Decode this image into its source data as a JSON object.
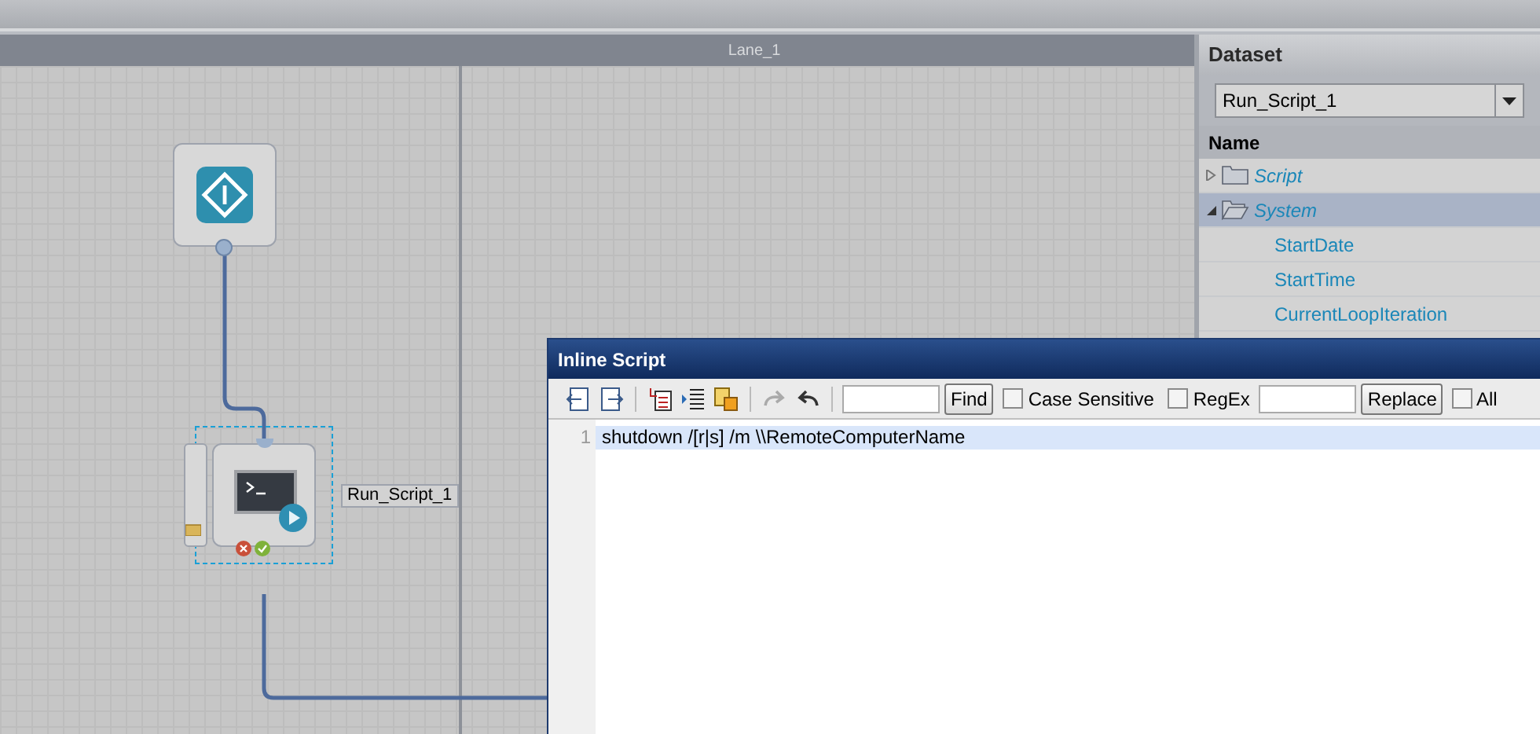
{
  "lane": {
    "title": "Lane_1"
  },
  "canvas": {
    "nodes": [
      {
        "kind": "start"
      },
      {
        "kind": "script",
        "label": "Run_Script_1",
        "selected": true
      }
    ]
  },
  "dataset": {
    "title": "Dataset",
    "dropdown": {
      "value": "Run_Script_1"
    },
    "column": "Name",
    "items": [
      {
        "name": "Script",
        "expanded": false,
        "selected": false
      },
      {
        "name": "System",
        "expanded": true,
        "selected": true,
        "children": [
          {
            "name": "StartDate"
          },
          {
            "name": "StartTime"
          },
          {
            "name": "CurrentLoopIteration"
          }
        ]
      }
    ]
  },
  "dialog": {
    "title": "Inline Script",
    "find_button": "Find",
    "replace_button": "Replace",
    "options": [
      {
        "label": "Case Sensitive",
        "checked": false
      },
      {
        "label": "RegEx",
        "checked": false
      }
    ],
    "all": {
      "label": "All",
      "checked": false
    },
    "lines": [
      {
        "number": "1",
        "text": "shutdown /[r|s] /m \\\\RemoteComputerName",
        "current": true
      }
    ]
  }
}
